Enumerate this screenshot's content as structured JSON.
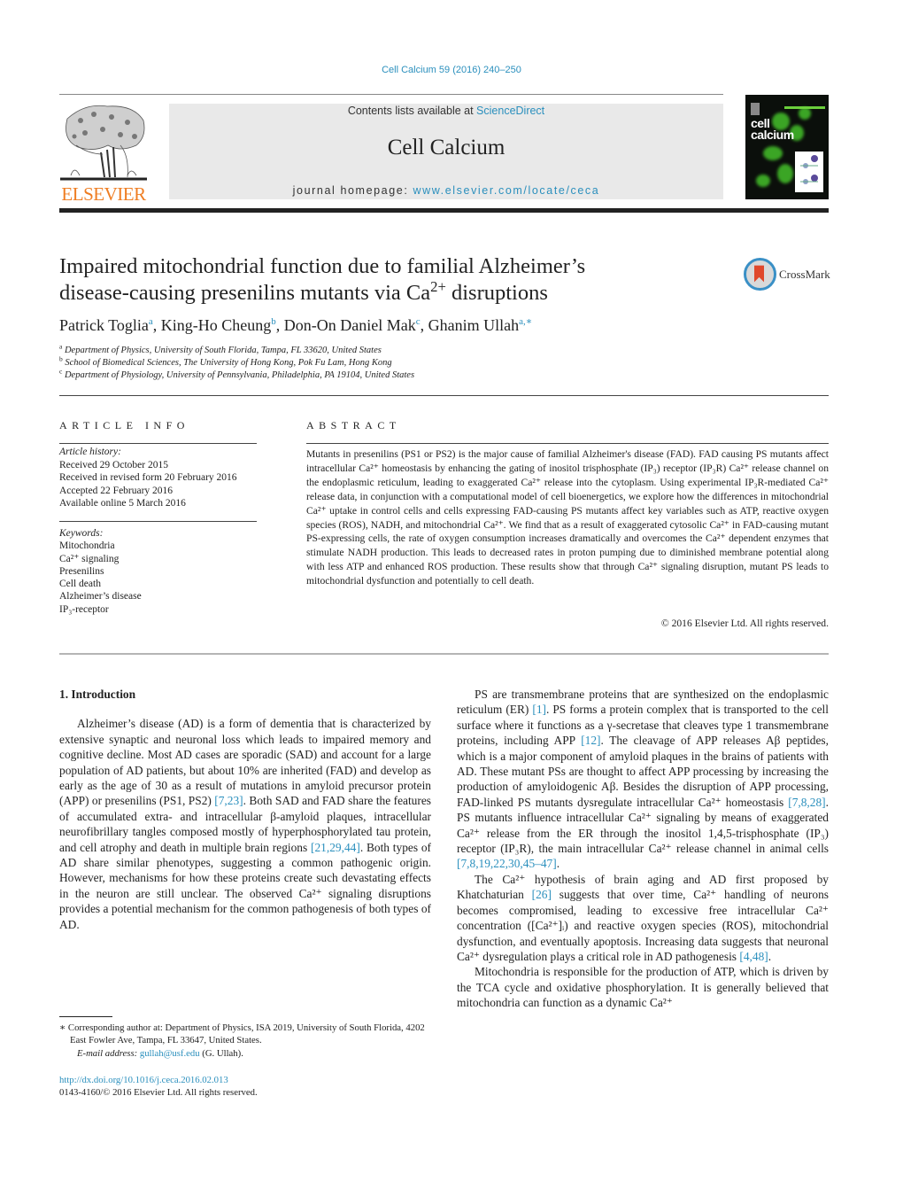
{
  "header": {
    "journal_ref": "Cell Calcium 59 (2016) 240–250",
    "contents_prefix": "Contents lists available at ",
    "contents_link": "ScienceDirect",
    "journal_name": "Cell Calcium",
    "homepage_prefix": "journal homepage: ",
    "homepage_link": "www.elsevier.com/locate/ceca",
    "publisher": "ELSEVIER",
    "cover_title_1": "cell",
    "cover_title_2": "calcium",
    "publisher_color": "#ef7d22",
    "link_color": "#2a8fbd"
  },
  "article": {
    "title_line1": "Impaired mitochondrial function due to familial Alzheimer’s",
    "title_line2_pre": "disease-causing presenilins mutants via Ca",
    "title_line2_sup": "2+",
    "title_line2_post": " disruptions",
    "crossmark": "CrossMark",
    "authors": [
      {
        "name": "Patrick Toglia",
        "sup": "a",
        "sep": ", "
      },
      {
        "name": "King-Ho Cheung",
        "sup": "b",
        "sep": ", "
      },
      {
        "name": "Don-On Daniel Mak",
        "sup": "c",
        "sep": ", "
      },
      {
        "name": "Ghanim Ullah",
        "sup": "a,∗",
        "sep": ""
      }
    ],
    "affiliations": [
      {
        "sup": "a",
        "text": "Department of Physics, University of South Florida, Tampa, FL 33620, United States"
      },
      {
        "sup": "b",
        "text": "School of Biomedical Sciences, The University of Hong Kong, Pok Fu Lam, Hong Kong"
      },
      {
        "sup": "c",
        "text": "Department of Physiology, University of Pennsylvania, Philadelphia, PA 19104, United States"
      }
    ]
  },
  "article_info": {
    "heading": "ARTICLE INFO",
    "history_label": "Article history:",
    "history": [
      "Received 29 October 2015",
      "Received in revised form 20 February 2016",
      "Accepted 22 February 2016",
      "Available online 5 March 2016"
    ],
    "keywords_label": "Keywords:",
    "keywords": [
      "Mitochondria",
      "Ca²⁺ signaling",
      "Presenilins",
      "Cell death",
      "Alzheimer’s disease",
      "IP₃-receptor"
    ]
  },
  "abstract": {
    "heading": "ABSTRACT",
    "text": "Mutants in presenilins (PS1 or PS2) is the major cause of familial Alzheimer's disease (FAD). FAD causing PS mutants affect intracellular Ca²⁺ homeostasis by enhancing the gating of inositol trisphosphate (IP₃) receptor (IP₃R) Ca²⁺ release channel on the endoplasmic reticulum, leading to exaggerated Ca²⁺ release into the cytoplasm. Using experimental IP₃R-mediated Ca²⁺ release data, in conjunction with a computational model of cell bioenergetics, we explore how the differences in mitochondrial Ca²⁺ uptake in control cells and cells expressing FAD-causing PS mutants affect key variables such as ATP, reactive oxygen species (ROS), NADH, and mitochondrial Ca²⁺. We find that as a result of exaggerated cytosolic Ca²⁺ in FAD-causing mutant PS-expressing cells, the rate of oxygen consumption increases dramatically and overcomes the Ca²⁺ dependent enzymes that stimulate NADH production. This leads to decreased rates in proton pumping due to diminished membrane potential along with less ATP and enhanced ROS production. These results show that through Ca²⁺ signaling disruption, mutant PS leads to mitochondrial dysfunction and potentially to cell death.",
    "copyright": "© 2016 Elsevier Ltd. All rights reserved."
  },
  "body": {
    "section_title": "1.  Introduction",
    "left_paragraphs": [
      [
        {
          "t": "Alzheimer’s disease (AD) is a form of dementia that is characterized by extensive synaptic and neuronal loss which leads to impaired memory and cognitive decline. Most AD cases are sporadic (SAD) and account for a large population of AD patients, but about 10% are inherited (FAD) and develop as early as the age of 30 as a result of mutations in amyloid precursor protein (APP) or presenilins (PS1, PS2) "
        },
        {
          "ref": "[7,23]"
        },
        {
          "t": ". Both SAD and FAD share the features of accumulated extra- and intracellular β-amyloid plaques, intracellular neurofibrillary tangles composed mostly of hyperphosphorylated tau protein, and cell atrophy and death in multiple brain regions "
        },
        {
          "ref": "[21,29,44]"
        },
        {
          "t": ". Both types of AD share similar phenotypes, suggesting a common pathogenic origin. However, mechanisms for how these proteins create such devastating effects in the neuron are still unclear. The observed Ca²⁺ signaling disruptions provides a potential mechanism for the common pathogenesis of both types of AD."
        }
      ]
    ],
    "right_paragraphs": [
      [
        {
          "t": "PS are transmembrane proteins that are synthesized on the endoplasmic reticulum (ER) "
        },
        {
          "ref": "[1]"
        },
        {
          "t": ". PS forms a protein complex that is transported to the cell surface where it functions as a γ-secretase that cleaves type 1 transmembrane proteins, including APP "
        },
        {
          "ref": "[12]"
        },
        {
          "t": ". The cleavage of APP releases Aβ peptides, which is a major component of amyloid plaques in the brains of patients with AD. These mutant PSs are thought to affect APP processing by increasing the production of amyloidogenic Aβ. Besides the disruption of APP processing, FAD-linked PS mutants dysregulate intracellular Ca²⁺ homeostasis "
        },
        {
          "ref": "[7,8,28]"
        },
        {
          "t": ". PS mutants influence intracellular Ca²⁺ signaling by means of exaggerated Ca²⁺ release from the ER through the inositol 1,4,5-trisphosphate (IP₃) receptor (IP₃R), the main intracellular Ca²⁺ release channel in animal cells "
        },
        {
          "ref": "[7,8,19,22,30,45–47]"
        },
        {
          "t": "."
        }
      ],
      [
        {
          "t": "The Ca²⁺ hypothesis of brain aging and AD first proposed by Khatchaturian "
        },
        {
          "ref": "[26]"
        },
        {
          "t": " suggests that over time, Ca²⁺ handling of neurons becomes compromised, leading to excessive free intracellular Ca²⁺ concentration ([Ca²⁺]ᵢ) and reactive oxygen species (ROS), mitochondrial dysfunction, and eventually apoptosis. Increasing data suggests that neuronal Ca²⁺ dysregulation plays a critical role in AD pathogenesis "
        },
        {
          "ref": "[4,48]"
        },
        {
          "t": "."
        }
      ],
      [
        {
          "t": "Mitochondria is responsible for the production of ATP, which is driven by the TCA cycle and oxidative phosphorylation. It is generally believed that mitochondria can function as a dynamic Ca²⁺"
        }
      ]
    ]
  },
  "footnotes": {
    "corresponding": "∗  Corresponding author at: Department of Physics, ISA 2019, University of South Florida, 4202 East Fowler Ave, Tampa, FL 33647, United States.",
    "email_label": "E-mail address: ",
    "email": "gullah@usf.edu",
    "email_suffix": " (G. Ullah).",
    "doi": "http://dx.doi.org/10.1016/j.ceca.2016.02.013",
    "issn_copyright": "0143-4160/© 2016 Elsevier Ltd. All rights reserved."
  }
}
